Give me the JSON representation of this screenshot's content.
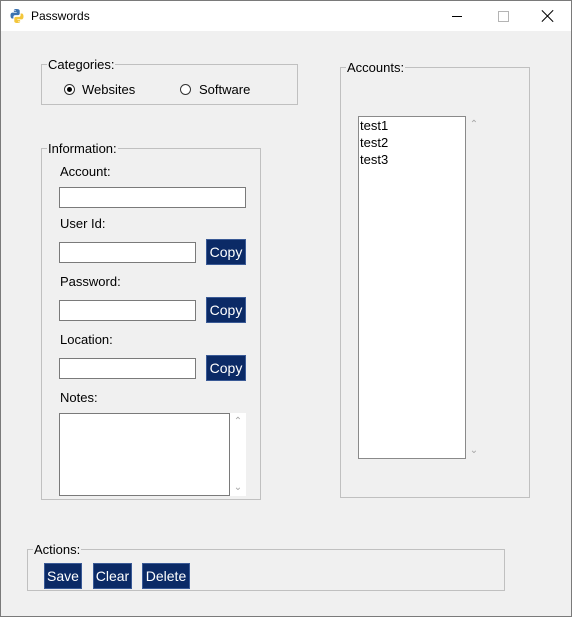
{
  "window": {
    "title": "Passwords",
    "icon": "python-icon",
    "controls": [
      "minimize",
      "maximize",
      "close"
    ]
  },
  "categories": {
    "legend": "Categories:",
    "options": [
      {
        "label": "Websites",
        "selected": true
      },
      {
        "label": "Software",
        "selected": false
      }
    ]
  },
  "information": {
    "legend": "Information:",
    "account_label": "Account:",
    "account_value": "",
    "userid_label": "User Id:",
    "userid_value": "",
    "password_label": "Password:",
    "password_value": "",
    "location_label": "Location:",
    "location_value": "",
    "notes_label": "Notes:",
    "notes_value": "",
    "copy_label": "Copy"
  },
  "accounts": {
    "legend": "Accounts:",
    "items": [
      "test1",
      "test2",
      "test3"
    ]
  },
  "actions": {
    "legend": "Actions:",
    "save_label": "Save",
    "clear_label": "Clear",
    "delete_label": "Delete"
  },
  "colors": {
    "button_bg": "#0b2a66",
    "button_text": "#ffffff",
    "window_bg": "#f0f0f0"
  }
}
